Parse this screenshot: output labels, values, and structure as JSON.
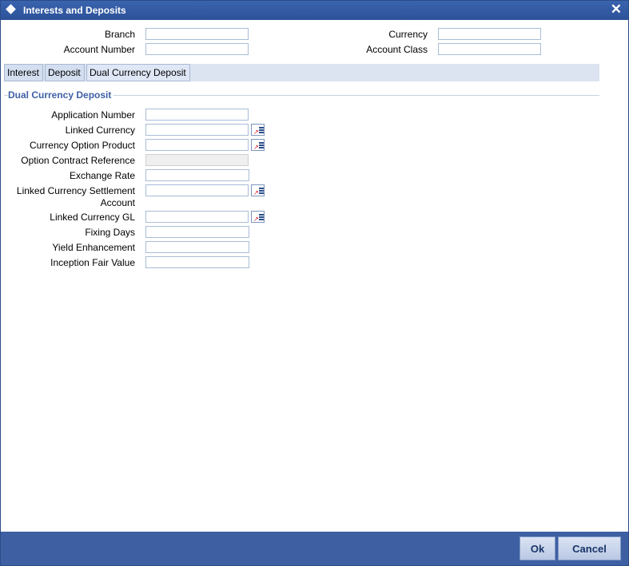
{
  "window": {
    "title": "Interests and Deposits",
    "close_glyph": "✕"
  },
  "header": {
    "branch": {
      "label": "Branch",
      "value": ""
    },
    "account_number": {
      "label": "Account Number",
      "value": ""
    },
    "currency": {
      "label": "Currency",
      "value": ""
    },
    "account_class": {
      "label": "Account Class",
      "value": ""
    }
  },
  "tabs": [
    {
      "label": "Interest"
    },
    {
      "label": "Deposit"
    },
    {
      "label": "Dual Currency Deposit",
      "active": true
    }
  ],
  "section": {
    "title": "Dual Currency Deposit",
    "fields": {
      "application_number": {
        "label": "Application Number",
        "value": ""
      },
      "linked_currency": {
        "label": "Linked Currency",
        "value": ""
      },
      "currency_option_product": {
        "label": "Currency Option Product",
        "value": ""
      },
      "option_contract_reference": {
        "label": "Option Contract Reference",
        "value": ""
      },
      "exchange_rate": {
        "label": "Exchange Rate",
        "value": ""
      },
      "linked_currency_settlement_account": {
        "label_line1": "Linked Currency Settlement",
        "label_line2": "Account",
        "value": ""
      },
      "linked_currency_gl": {
        "label": "Linked Currency GL",
        "value": ""
      },
      "fixing_days": {
        "label": "Fixing Days",
        "value": ""
      },
      "yield_enhancement": {
        "label": "Yield Enhancement",
        "value": ""
      },
      "inception_fair_value": {
        "label": "Inception Fair Value",
        "value": ""
      }
    }
  },
  "footer": {
    "ok_label": "Ok",
    "cancel_label": "Cancel"
  },
  "colors": {
    "titlebar": "#2c5299",
    "footer": "#3e5fa2",
    "section_title": "#3e60a6",
    "tab_strip": "#dce4f2"
  },
  "icons": {
    "title": "diamond-icon",
    "lov": "list-of-values-icon",
    "close": "close-icon"
  }
}
